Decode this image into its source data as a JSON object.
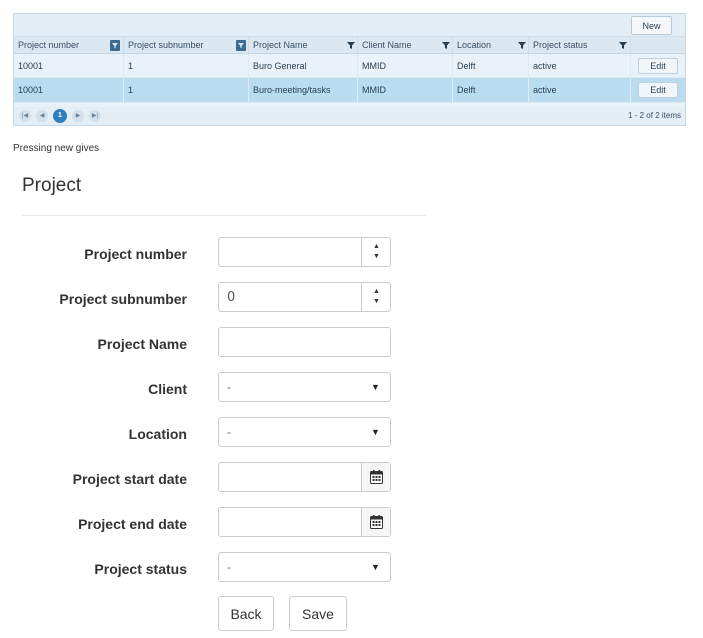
{
  "grid": {
    "new_label": "New",
    "columns": [
      {
        "label": "Project number"
      },
      {
        "label": "Project subnumber"
      },
      {
        "label": "Project Name"
      },
      {
        "label": "Client Name"
      },
      {
        "label": "Location"
      },
      {
        "label": "Project status"
      }
    ],
    "rows": [
      {
        "number": "10001",
        "subnumber": "1",
        "name": "Buro General",
        "client": "MMID",
        "location": "Delft",
        "status": "active",
        "edit_label": "Edit"
      },
      {
        "number": "10001",
        "subnumber": "1",
        "name": "Buro-meeting/tasks",
        "client": "MMID",
        "location": "Delft",
        "status": "active",
        "edit_label": "Edit"
      }
    ],
    "pager": {
      "current_page": "1",
      "info": "1 - 2 of 2 items",
      "first_icon": "first-page-icon",
      "prev_icon": "previous-page-icon",
      "next_icon": "next-page-icon",
      "last_icon": "last-page-icon"
    },
    "selected_row_color": "#b9dcf1",
    "header_color": "#dbe8f2"
  },
  "note": "Pressing new gives",
  "form": {
    "title": "Project",
    "fields": {
      "project_number": {
        "label": "Project number",
        "value": ""
      },
      "project_subnumber": {
        "label": "Project subnumber",
        "value": "0"
      },
      "project_name": {
        "label": "Project Name",
        "value": ""
      },
      "client": {
        "label": "Client",
        "value": "-"
      },
      "location": {
        "label": "Location",
        "value": "-"
      },
      "start_date": {
        "label": "Project start date",
        "value": ""
      },
      "end_date": {
        "label": "Project end date",
        "value": ""
      },
      "status": {
        "label": "Project status",
        "value": "-"
      }
    },
    "back_label": "Back",
    "save_label": "Save"
  }
}
